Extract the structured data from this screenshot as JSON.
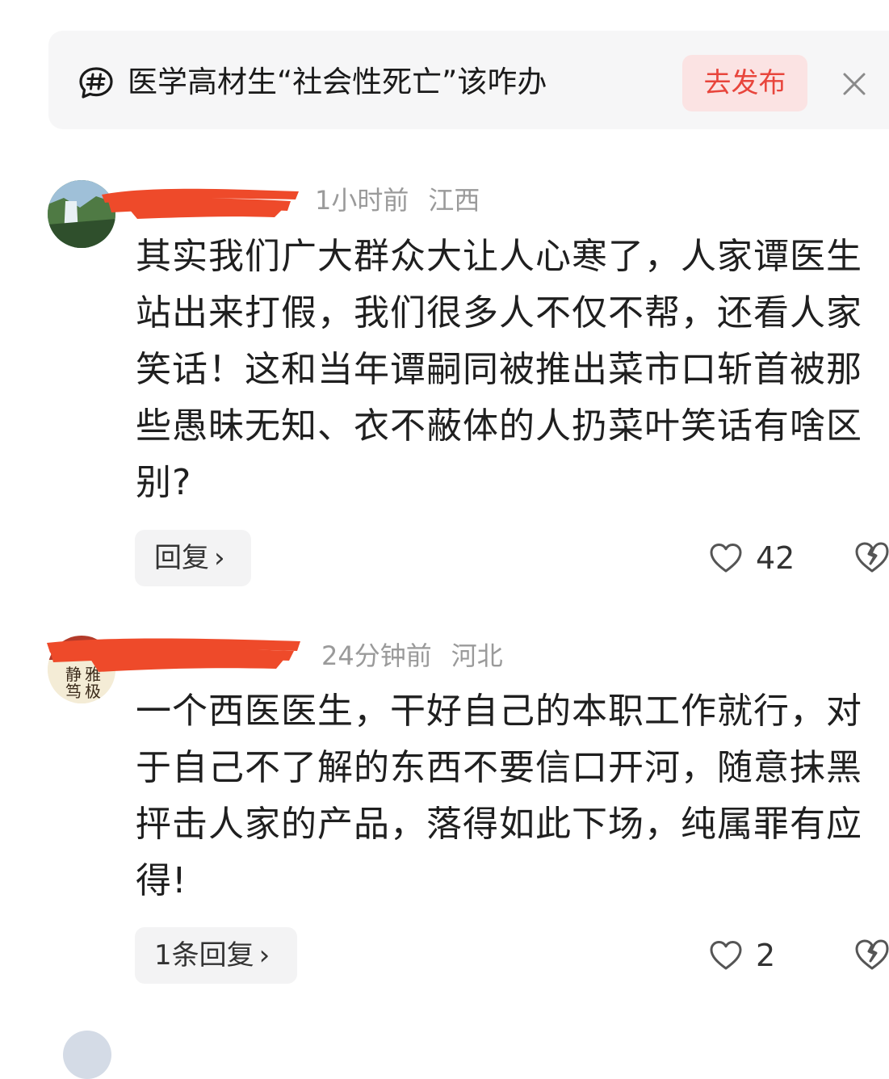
{
  "topic": {
    "icon": "hashtag-bubble-icon",
    "title": "医学高材生“社会性死亡”该咋办",
    "publish_label": "去发布",
    "close_icon": "close-icon"
  },
  "comments": [
    {
      "username": "",
      "time": "1小时前",
      "location": "江西",
      "text": "其实我们广大群众大让人心寒了，人家谭医生站出来打假，我们很多人不仅不帮，还看人家笑话！这和当年谭嗣同被推出菜市口斩首被那些愚昧无知、衣不蔽体的人扔菜叶笑话有啥区别?",
      "reply_label": "回复",
      "likes": "42"
    },
    {
      "username": "",
      "time": "24分钟前",
      "location": "河北",
      "text": "一个西医医生，干好自己的本职工作就行，对于自己不了解的东西不要信口开河，随意抹黑抨击人家的产品，落得如此下场，纯属罪有应得!",
      "reply_label": "1条回复",
      "likes": "2"
    }
  ],
  "colors": {
    "accent": "#e8453c",
    "redaction": "#ee4a2a",
    "meta": "#9a9a9a"
  }
}
